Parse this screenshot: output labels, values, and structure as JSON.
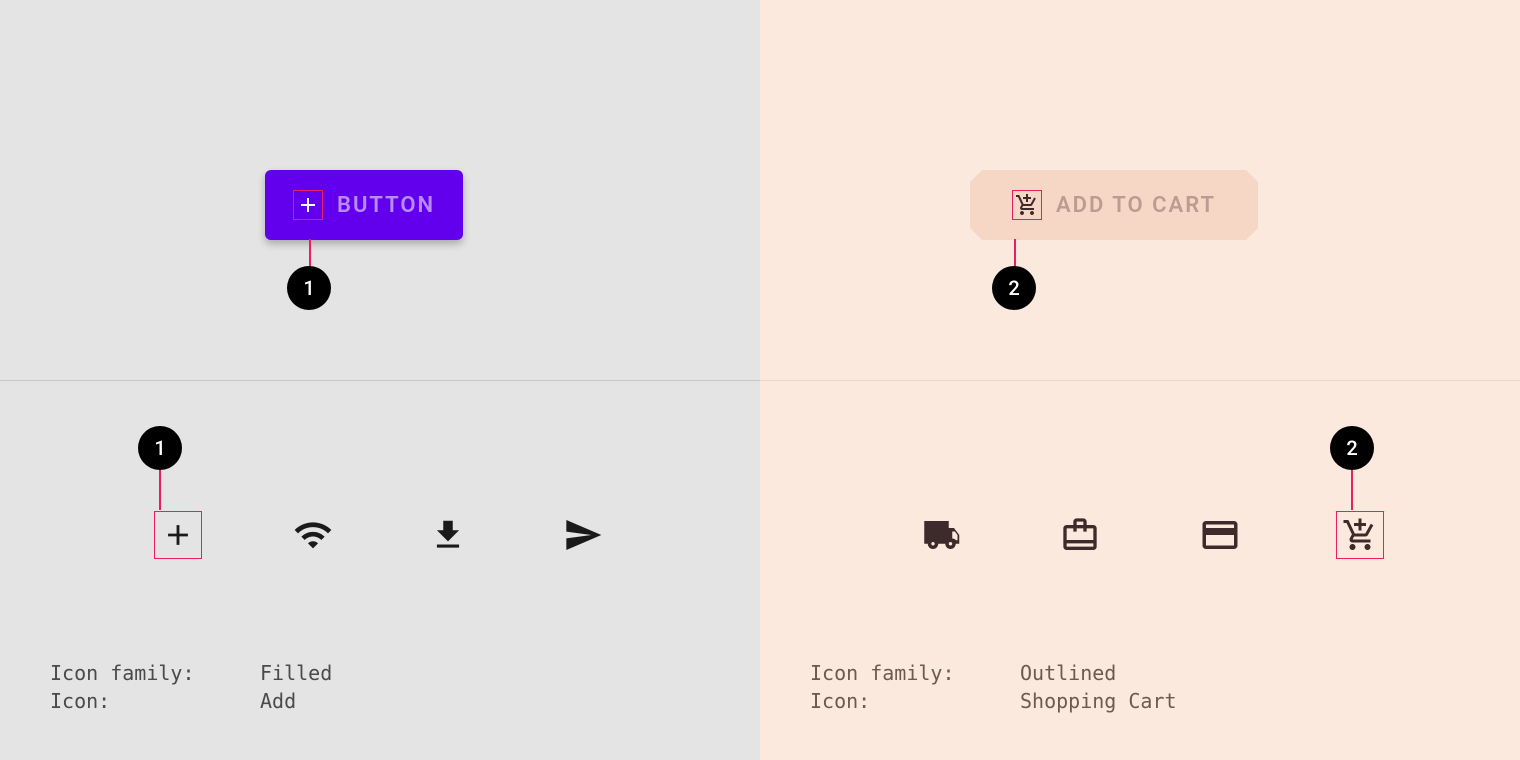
{
  "left": {
    "button_label": "BUTTON",
    "button_icon": "plus-icon",
    "callout_number": "1",
    "icons": [
      "plus-icon",
      "wifi-icon",
      "download-icon",
      "send-icon"
    ],
    "highlight_index": 0,
    "row_callout_number": "1",
    "meta": {
      "family_label": "Icon family:",
      "family_value": "Filled",
      "icon_label": "Icon:",
      "icon_value": "Add"
    }
  },
  "right": {
    "button_label": "ADD TO CART",
    "button_icon": "add-shopping-cart-icon",
    "callout_number": "2",
    "icons": [
      "truck-icon",
      "briefcase-icon",
      "credit-card-icon",
      "add-shopping-cart-icon"
    ],
    "highlight_index": 3,
    "row_callout_number": "2",
    "meta": {
      "family_label": "Icon family:",
      "family_value": "Outlined",
      "icon_label": "Icon:",
      "icon_value": "Shopping Cart"
    }
  }
}
